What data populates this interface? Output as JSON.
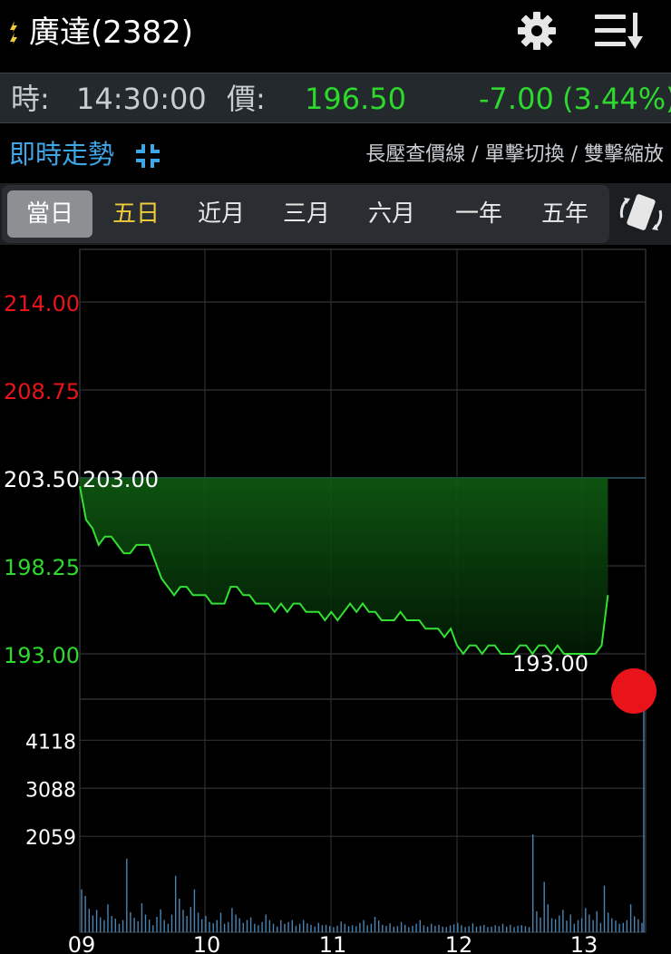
{
  "header": {
    "title": "廣達(2382)",
    "icons": [
      "flash-icon",
      "gear-icon",
      "sort-menu-icon"
    ]
  },
  "quote": {
    "time_label": "時:",
    "time": "14:30:00",
    "price_label": "價:",
    "price": "196.50",
    "change": "-7.00",
    "change_pct": "(3.44%)"
  },
  "mode": {
    "title": "即時走勢",
    "hint": "長壓查價線 / 單擊切換 / 雙擊縮放",
    "icon": "collapse-icon"
  },
  "tabs": [
    {
      "label": "當日",
      "active": true
    },
    {
      "label": "五日",
      "special": true
    },
    {
      "label": "近月"
    },
    {
      "label": "三月"
    },
    {
      "label": "六月"
    },
    {
      "label": "一年"
    },
    {
      "label": "五年"
    }
  ],
  "colors": {
    "up": "#e8141a",
    "down": "#2cd92c",
    "accent": "#3fa6e8",
    "line": "#33e033",
    "volume": "#4a84b3",
    "grid": "#2c3034"
  },
  "chart_data": {
    "type": "line",
    "price": {
      "y_ticks": [
        {
          "value": 214.0,
          "label": "214.00",
          "color": "#e8141a"
        },
        {
          "value": 208.75,
          "label": "208.75",
          "color": "#e8141a"
        },
        {
          "value": 203.5,
          "label": "203.50",
          "color": "#ffffff"
        },
        {
          "value": 198.25,
          "label": "198.25",
          "color": "#2cd92c"
        },
        {
          "value": 193.0,
          "label": "193.00",
          "color": "#2cd92c"
        }
      ],
      "ylim": [
        193.0,
        214.0
      ],
      "reference": 203.5,
      "high_label": "203.00",
      "low_label": "193.00",
      "series": [
        [
          0,
          203.0
        ],
        [
          1,
          201.0
        ],
        [
          2,
          200.5
        ],
        [
          3,
          199.5
        ],
        [
          4,
          200.0
        ],
        [
          5,
          200.0
        ],
        [
          6,
          199.5
        ],
        [
          7,
          199.0
        ],
        [
          8,
          199.0
        ],
        [
          9,
          199.5
        ],
        [
          10,
          199.5
        ],
        [
          11,
          199.5
        ],
        [
          12,
          198.5
        ],
        [
          13,
          197.5
        ],
        [
          14,
          197.0
        ],
        [
          15,
          196.5
        ],
        [
          16,
          197.0
        ],
        [
          17,
          197.0
        ],
        [
          18,
          196.5
        ],
        [
          19,
          196.5
        ],
        [
          20,
          196.5
        ],
        [
          21,
          196.0
        ],
        [
          22,
          196.0
        ],
        [
          23,
          196.0
        ],
        [
          24,
          197.0
        ],
        [
          25,
          197.0
        ],
        [
          26,
          196.5
        ],
        [
          27,
          196.5
        ],
        [
          28,
          196.0
        ],
        [
          29,
          196.0
        ],
        [
          30,
          196.0
        ],
        [
          31,
          195.5
        ],
        [
          32,
          196.0
        ],
        [
          33,
          195.5
        ],
        [
          34,
          196.0
        ],
        [
          35,
          196.0
        ],
        [
          36,
          195.5
        ],
        [
          37,
          195.5
        ],
        [
          38,
          195.5
        ],
        [
          39,
          195.0
        ],
        [
          40,
          195.5
        ],
        [
          41,
          195.0
        ],
        [
          42,
          195.5
        ],
        [
          43,
          196.0
        ],
        [
          44,
          195.5
        ],
        [
          45,
          196.0
        ],
        [
          46,
          195.5
        ],
        [
          47,
          195.5
        ],
        [
          48,
          195.0
        ],
        [
          49,
          195.0
        ],
        [
          50,
          195.0
        ],
        [
          51,
          195.5
        ],
        [
          52,
          195.0
        ],
        [
          53,
          195.0
        ],
        [
          54,
          195.0
        ],
        [
          55,
          194.5
        ],
        [
          56,
          194.5
        ],
        [
          57,
          194.5
        ],
        [
          58,
          194.0
        ],
        [
          59,
          194.5
        ],
        [
          60,
          193.5
        ],
        [
          61,
          193.0
        ],
        [
          62,
          193.5
        ],
        [
          63,
          193.5
        ],
        [
          64,
          193.0
        ],
        [
          65,
          193.5
        ],
        [
          66,
          193.5
        ],
        [
          67,
          193.0
        ],
        [
          68,
          193.0
        ],
        [
          69,
          193.0
        ],
        [
          70,
          193.5
        ],
        [
          71,
          193.5
        ],
        [
          72,
          193.0
        ],
        [
          73,
          193.5
        ],
        [
          74,
          193.5
        ],
        [
          75,
          193.0
        ],
        [
          76,
          193.5
        ],
        [
          77,
          193.0
        ],
        [
          78,
          193.0
        ],
        [
          79,
          193.0
        ],
        [
          80,
          193.0
        ],
        [
          81,
          193.0
        ],
        [
          82,
          193.0
        ],
        [
          83,
          193.5
        ],
        [
          84,
          196.5
        ]
      ],
      "x_max": 90
    },
    "volume": {
      "y_ticks": [
        4118,
        3088,
        2059
      ],
      "ylim": [
        0,
        5000
      ],
      "values": [
        920,
        780,
        500,
        360,
        480,
        320,
        260,
        600,
        350,
        290,
        180,
        260,
        1580,
        430,
        310,
        240,
        620,
        380,
        270,
        150,
        330,
        490,
        260,
        180,
        380,
        1210,
        720,
        480,
        350,
        540,
        920,
        420,
        280,
        350,
        220,
        190,
        260,
        420,
        180,
        220,
        520,
        380,
        300,
        200,
        260,
        320,
        180,
        150,
        220,
        380,
        260,
        180,
        120,
        260,
        180,
        220,
        260,
        140,
        180,
        260,
        190,
        160,
        120,
        200,
        150,
        160,
        130,
        110,
        140,
        230,
        180,
        130,
        150,
        130,
        200,
        260,
        150,
        180,
        330,
        250,
        160,
        140,
        190,
        120,
        130,
        220,
        160,
        110,
        140,
        180,
        260,
        150,
        120,
        180,
        140,
        160,
        120,
        110,
        150,
        170,
        200,
        150,
        110,
        130,
        190,
        120,
        140,
        160,
        110,
        120,
        150,
        130,
        180,
        120,
        160,
        110,
        140,
        150,
        130,
        110,
        2100,
        450,
        320,
        1080,
        600,
        300,
        280,
        360,
        480,
        250,
        380,
        180,
        260,
        300,
        520,
        380,
        260,
        450,
        200,
        1000,
        420,
        300,
        250,
        180,
        200,
        260,
        600,
        340,
        280,
        200
      ],
      "last_bar": 4800
    },
    "x_ticks": [
      "09",
      "10",
      "11",
      "12",
      "13"
    ]
  }
}
